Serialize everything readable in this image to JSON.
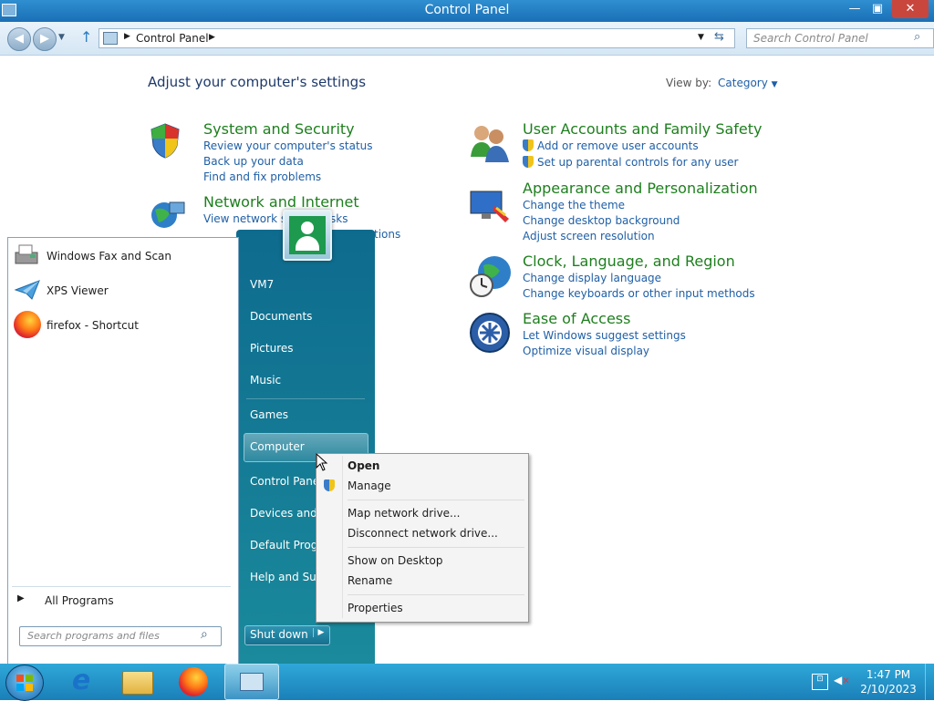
{
  "window": {
    "title": "Control Panel",
    "controls": [
      "—",
      "▣",
      "✕"
    ]
  },
  "address_bar": {
    "breadcrumb": "Control Panel",
    "search_placeholder": "Search Control Panel"
  },
  "control_panel": {
    "heading": "Adjust your computer's settings",
    "view_by_label": "View by:",
    "view_by_value": "Category",
    "categories": [
      {
        "title": "System and Security",
        "icon": "shield-icon",
        "links": [
          "Review your computer's status",
          "Back up your data",
          "Find and fix problems"
        ]
      },
      {
        "title": "Network and Internet",
        "icon": "network-icon",
        "links": [
          "View network sta",
          "sks",
          "tions"
        ]
      },
      {
        "title": "User Accounts and Family Safety",
        "icon": "users-icon",
        "links": [
          "Add or remove user accounts",
          "Set up parental controls for any user"
        ]
      },
      {
        "title": "Appearance and Personalization",
        "icon": "appearance-icon",
        "links": [
          "Change the theme",
          "Change desktop background",
          "Adjust screen resolution"
        ]
      },
      {
        "title": "Clock, Language, and Region",
        "icon": "clock-globe-icon",
        "links": [
          "Change display language",
          "Change keyboards or other input methods"
        ]
      },
      {
        "title": "Ease of Access",
        "icon": "ease-of-access-icon",
        "links": [
          "Let Windows suggest settings",
          "Optimize visual display"
        ]
      }
    ]
  },
  "start_menu": {
    "pinned": [
      {
        "label": "Windows Fax and Scan",
        "icon": "fax-icon"
      },
      {
        "label": "XPS Viewer",
        "icon": "xps-icon"
      },
      {
        "label": "firefox - Shortcut",
        "icon": "firefox-icon"
      }
    ],
    "all_programs": "All Programs",
    "search_placeholder": "Search programs and files",
    "right_items": [
      "VM7",
      "Documents",
      "Pictures",
      "Music",
      "Games",
      "Computer",
      "Control Panel",
      "Devices and P",
      "Default Progra",
      "Help and Sup"
    ],
    "shutdown": "Shut down"
  },
  "context_menu": {
    "items": [
      "Open",
      "Manage",
      "Map network drive...",
      "Disconnect network drive...",
      "Show on Desktop",
      "Rename",
      "Properties"
    ]
  },
  "taskbar": {
    "time": "1:47 PM",
    "date": "2/10/2023"
  }
}
